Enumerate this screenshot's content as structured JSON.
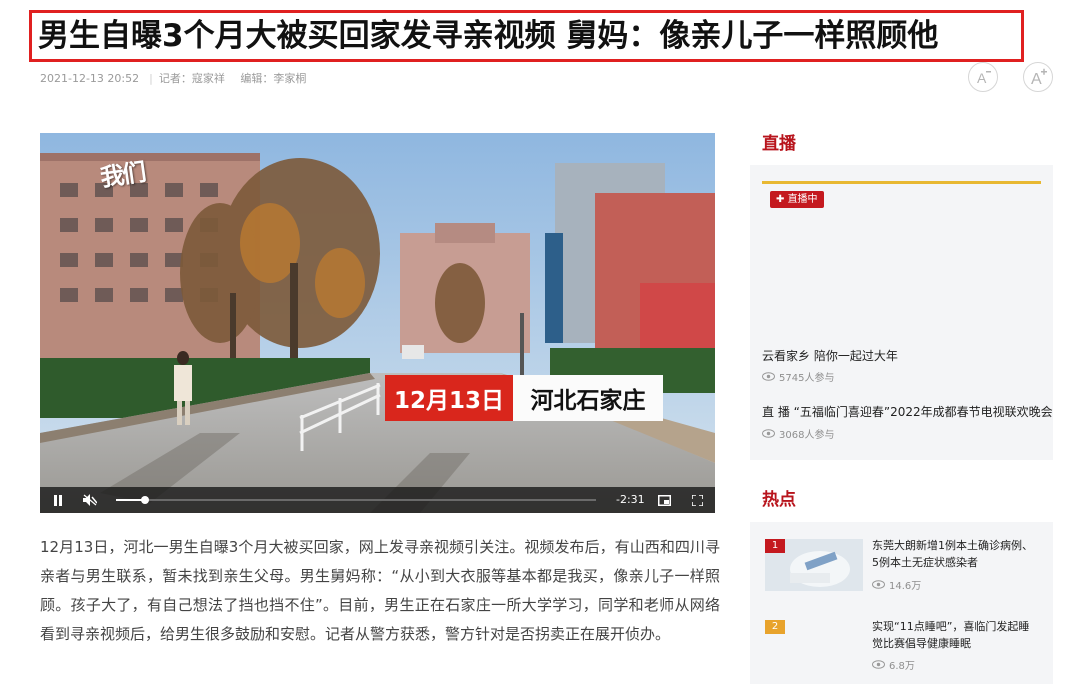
{
  "headline": "男生自曝3个月大被买回家发寻亲视频 舅妈：像亲儿子一样照顾他",
  "meta": {
    "datetime": "2021-12-13 20:52",
    "reporter": "记者：寇家祥",
    "editor": "编辑：李家桐"
  },
  "font_controls": {
    "decrease_icon": "font-decrease-icon",
    "increase_icon": "font-increase-icon"
  },
  "video": {
    "logo": "我们",
    "caption_date": "12月13日",
    "caption_place": "河北石家庄",
    "time_remaining": "-2:31",
    "progress": 0.06,
    "icons": [
      "pause-icon",
      "mute-icon",
      "picture-in-picture-icon",
      "fullscreen-icon"
    ]
  },
  "article": "12月13日，河北一男生自曝3个月大被买回家，网上发寻亲视频引关注。视频发布后，有山西和四川寻亲者与男生联系，暂未找到亲生父母。男生舅妈称：“从小到大衣服等基本都是我买，像亲儿子一样照顾。孩子大了，有自己想法了挡也挡不住”。目前，男生正在石家庄一所大学学习，同学和老师从网络看到寻亲视频后，给男生很多鼓励和安慰。记者从警方获悉，警方针对是否拐卖正在展开侦办。",
  "live": {
    "title": "直播",
    "badge": "直播中",
    "items": [
      {
        "title": "云看家乡 陪你一起过大年",
        "views": "5745人参与"
      },
      {
        "title": "直 播 “五福临门喜迎春”2022年成都春节电视联欢晚会",
        "views": "3068人参与"
      }
    ]
  },
  "hot": {
    "title": "热点",
    "items": [
      {
        "rank": "1",
        "title": "东莞大朗新增1例本土确诊病例、5例本土无症状感染者",
        "views": "14.6万",
        "rank_color": "#c4191f"
      },
      {
        "rank": "2",
        "title": "实现“11点睡吧”，喜临门发起睡觉比赛倡导健康睡眠",
        "views": "6.8万",
        "rank_color": "#e8a32c"
      }
    ]
  },
  "colors": {
    "accent": "#b8141c",
    "headline_border": "#e02020",
    "live_bar": "#e8b832"
  }
}
